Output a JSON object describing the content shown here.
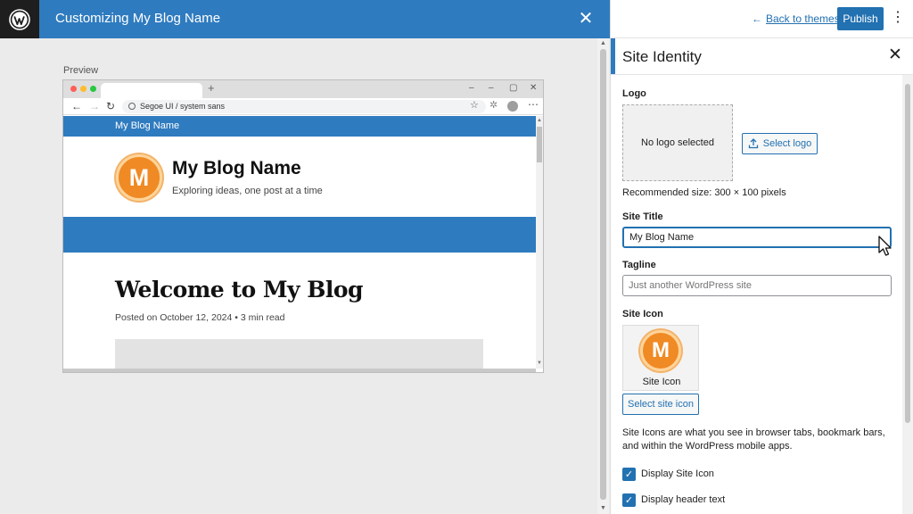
{
  "topbar": {
    "title": "Customizing My Blog Name",
    "close_glyph": "✕"
  },
  "preview": {
    "label": "Preview",
    "browser": {
      "address": "Segoe UI / system sans",
      "new_tab_glyph": "+",
      "site": {
        "nav_title": "My Blog Name",
        "logo_letter": "M",
        "name": "My Blog Name",
        "tagline": "Exploring ideas, one post at a time",
        "post_title": "Welcome to My Blog",
        "post_meta": "Posted on October 12, 2024 • 3 min read"
      }
    }
  },
  "header": {
    "back_label": "Back to themes",
    "publish_label": "Publish"
  },
  "section": {
    "title": "Site Identity",
    "logo": {
      "label": "Logo",
      "placeholder_text": "No logo selected",
      "select_button": "Select logo",
      "recommended": "Recommended size: 300 × 100 pixels"
    },
    "site_title": {
      "label": "Site Title",
      "value": "My Blog Name"
    },
    "tagline": {
      "label": "Tagline",
      "placeholder": "Just another WordPress site"
    },
    "site_icon": {
      "label": "Site Icon",
      "icon_letter": "M",
      "caption": "Site Icon",
      "select_button": "Select site icon",
      "description": "Site Icons are what you see in browser tabs, bookmark bars, and within the WordPress mobile apps."
    },
    "checkboxes": [
      {
        "label": "Display Site Icon",
        "checked": true
      },
      {
        "label": "Display header text",
        "checked": true
      }
    ]
  },
  "colors": {
    "wp_blue": "#2f7bbf",
    "admin_blue": "#2271b1",
    "logo_orange": "#f08a24"
  },
  "icons": [
    "wordpress-icon",
    "close-icon",
    "back-arrow-icon",
    "kebab-menu-icon",
    "upload-icon",
    "check-icon",
    "mouse-pointer-icon"
  ]
}
